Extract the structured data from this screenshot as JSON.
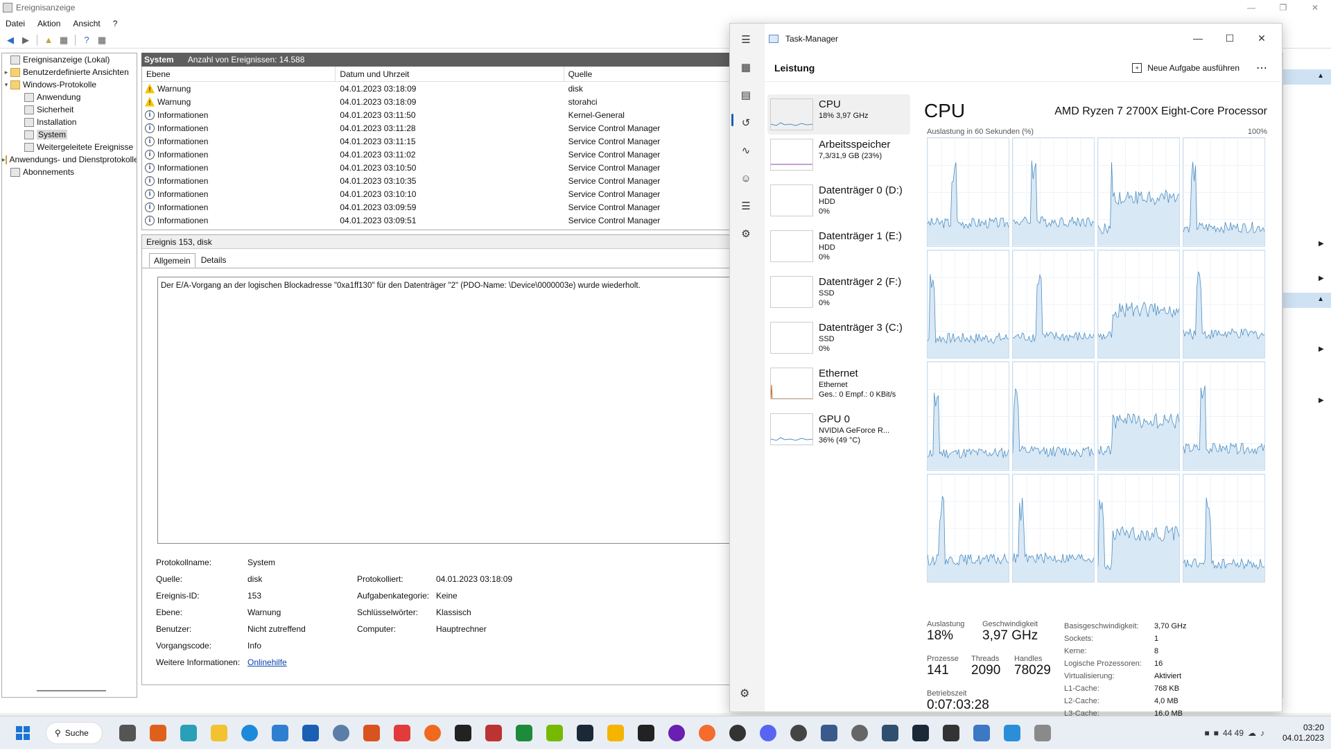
{
  "ev": {
    "title": "Ereignisanzeige",
    "menu": [
      "Datei",
      "Aktion",
      "Ansicht",
      "?"
    ],
    "tree": {
      "root": "Ereignisanzeige (Lokal)",
      "custom": "Benutzerdefinierte Ansichten",
      "winlogs": "Windows-Protokolle",
      "app": "Anwendung",
      "security": "Sicherheit",
      "setup": "Installation",
      "system": "System",
      "forwarded": "Weitergeleitete Ereignisse",
      "appsvc": "Anwendungs- und Dienstprotokolle",
      "subs": "Abonnements"
    },
    "header_name": "System",
    "header_count": "Anzahl von Ereignissen: 14.588",
    "columns": [
      "Ebene",
      "Datum und Uhrzeit",
      "Quelle"
    ],
    "rows": [
      {
        "level": "Warnung",
        "type": "warn",
        "date": "04.01.2023 03:18:09",
        "source": "disk"
      },
      {
        "level": "Warnung",
        "type": "warn",
        "date": "04.01.2023 03:18:09",
        "source": "storahci"
      },
      {
        "level": "Informationen",
        "type": "info",
        "date": "04.01.2023 03:11:50",
        "source": "Kernel-General"
      },
      {
        "level": "Informationen",
        "type": "info",
        "date": "04.01.2023 03:11:28",
        "source": "Service Control Manager"
      },
      {
        "level": "Informationen",
        "type": "info",
        "date": "04.01.2023 03:11:15",
        "source": "Service Control Manager"
      },
      {
        "level": "Informationen",
        "type": "info",
        "date": "04.01.2023 03:11:02",
        "source": "Service Control Manager"
      },
      {
        "level": "Informationen",
        "type": "info",
        "date": "04.01.2023 03:10:50",
        "source": "Service Control Manager"
      },
      {
        "level": "Informationen",
        "type": "info",
        "date": "04.01.2023 03:10:35",
        "source": "Service Control Manager"
      },
      {
        "level": "Informationen",
        "type": "info",
        "date": "04.01.2023 03:10:10",
        "source": "Service Control Manager"
      },
      {
        "level": "Informationen",
        "type": "info",
        "date": "04.01.2023 03:09:59",
        "source": "Service Control Manager"
      },
      {
        "level": "Informationen",
        "type": "info",
        "date": "04.01.2023 03:09:51",
        "source": "Service Control Manager"
      }
    ],
    "detail": {
      "title": "Ereignis 153, disk",
      "tab_general": "Allgemein",
      "tab_details": "Details",
      "message": "Der E/A-Vorgang an der logischen Blockadresse \"0xa1ff130\" für den Datenträger \"2\" (PDO-Name: \\Device\\0000003e) wurde wiederholt.",
      "log_name_label": "Protokollname:",
      "log_name": "System",
      "source_label": "Quelle:",
      "source": "disk",
      "logged_label": "Protokolliert:",
      "logged": "04.01.2023 03:18:09",
      "id_label": "Ereignis-ID:",
      "id": "153",
      "task_label": "Aufgabenkategorie:",
      "task": "Keine",
      "level_label": "Ebene:",
      "level": "Warnung",
      "keywords_label": "Schlüsselwörter:",
      "keywords": "Klassisch",
      "user_label": "Benutzer:",
      "user": "Nicht zutreffend",
      "computer_label": "Computer:",
      "computer": "Hauptrechner",
      "opcode_label": "Vorgangscode:",
      "opcode": "Info",
      "moreinfo_label": "Weitere Informationen:",
      "moreinfo": "Onlinehilfe"
    }
  },
  "tm": {
    "title": "Task-Manager",
    "section": "Leistung",
    "new_task": "Neue Aufgabe ausführen",
    "items": [
      {
        "title": "CPU",
        "sub1": "18% 3,97 GHz",
        "sub2": "",
        "color": "#4a90c8"
      },
      {
        "title": "Arbeitsspeicher",
        "sub1": "7,3/31,9 GB (23%)",
        "sub2": "",
        "color": "#8b3fa8"
      },
      {
        "title": "Datenträger 0 (D:)",
        "sub1": "HDD",
        "sub2": "0%",
        "color": "#3d8f3d"
      },
      {
        "title": "Datenträger 1 (E:)",
        "sub1": "HDD",
        "sub2": "0%",
        "color": "#3d8f3d"
      },
      {
        "title": "Datenträger 2 (F:)",
        "sub1": "SSD",
        "sub2": "0%",
        "color": "#3d8f3d"
      },
      {
        "title": "Datenträger 3 (C:)",
        "sub1": "SSD",
        "sub2": "0%",
        "color": "#3d8f3d"
      },
      {
        "title": "Ethernet",
        "sub1": "Ethernet",
        "sub2": "Ges.: 0 Empf.: 0 KBit/s",
        "color": "#c26a2a"
      },
      {
        "title": "GPU 0",
        "sub1": "NVIDIA GeForce R...",
        "sub2": "36% (49 °C)",
        "color": "#4a90c8"
      }
    ],
    "cpu": {
      "heading": "CPU",
      "model": "AMD Ryzen 7 2700X Eight-Core Processor",
      "usage_label": "Auslastung in 60 Sekunden (%)",
      "max_label": "100%"
    },
    "stats": {
      "util_label": "Auslastung",
      "util": "18%",
      "speed_label": "Geschwindigkeit",
      "speed": "3,97 GHz",
      "proc_label": "Prozesse",
      "proc": "141",
      "threads_label": "Threads",
      "threads": "2090",
      "handles_label": "Handles",
      "handles": "78029",
      "uptime_label": "Betriebszeit",
      "uptime": "0:07:03:28"
    },
    "sysinfo": [
      {
        "k": "Basisgeschwindigkeit:",
        "v": "3,70 GHz"
      },
      {
        "k": "Sockets:",
        "v": "1"
      },
      {
        "k": "Kerne:",
        "v": "8"
      },
      {
        "k": "Logische Prozessoren:",
        "v": "16"
      },
      {
        "k": "Virtualisierung:",
        "v": "Aktiviert"
      },
      {
        "k": "L1-Cache:",
        "v": "768 KB"
      },
      {
        "k": "L2-Cache:",
        "v": "4,0 MB"
      },
      {
        "k": "L3-Cache:",
        "v": "16,0 MB"
      }
    ]
  },
  "taskbar": {
    "search": "Suche",
    "tray_nums": "44  49",
    "time": "03:20",
    "date": "04.01.2023"
  }
}
